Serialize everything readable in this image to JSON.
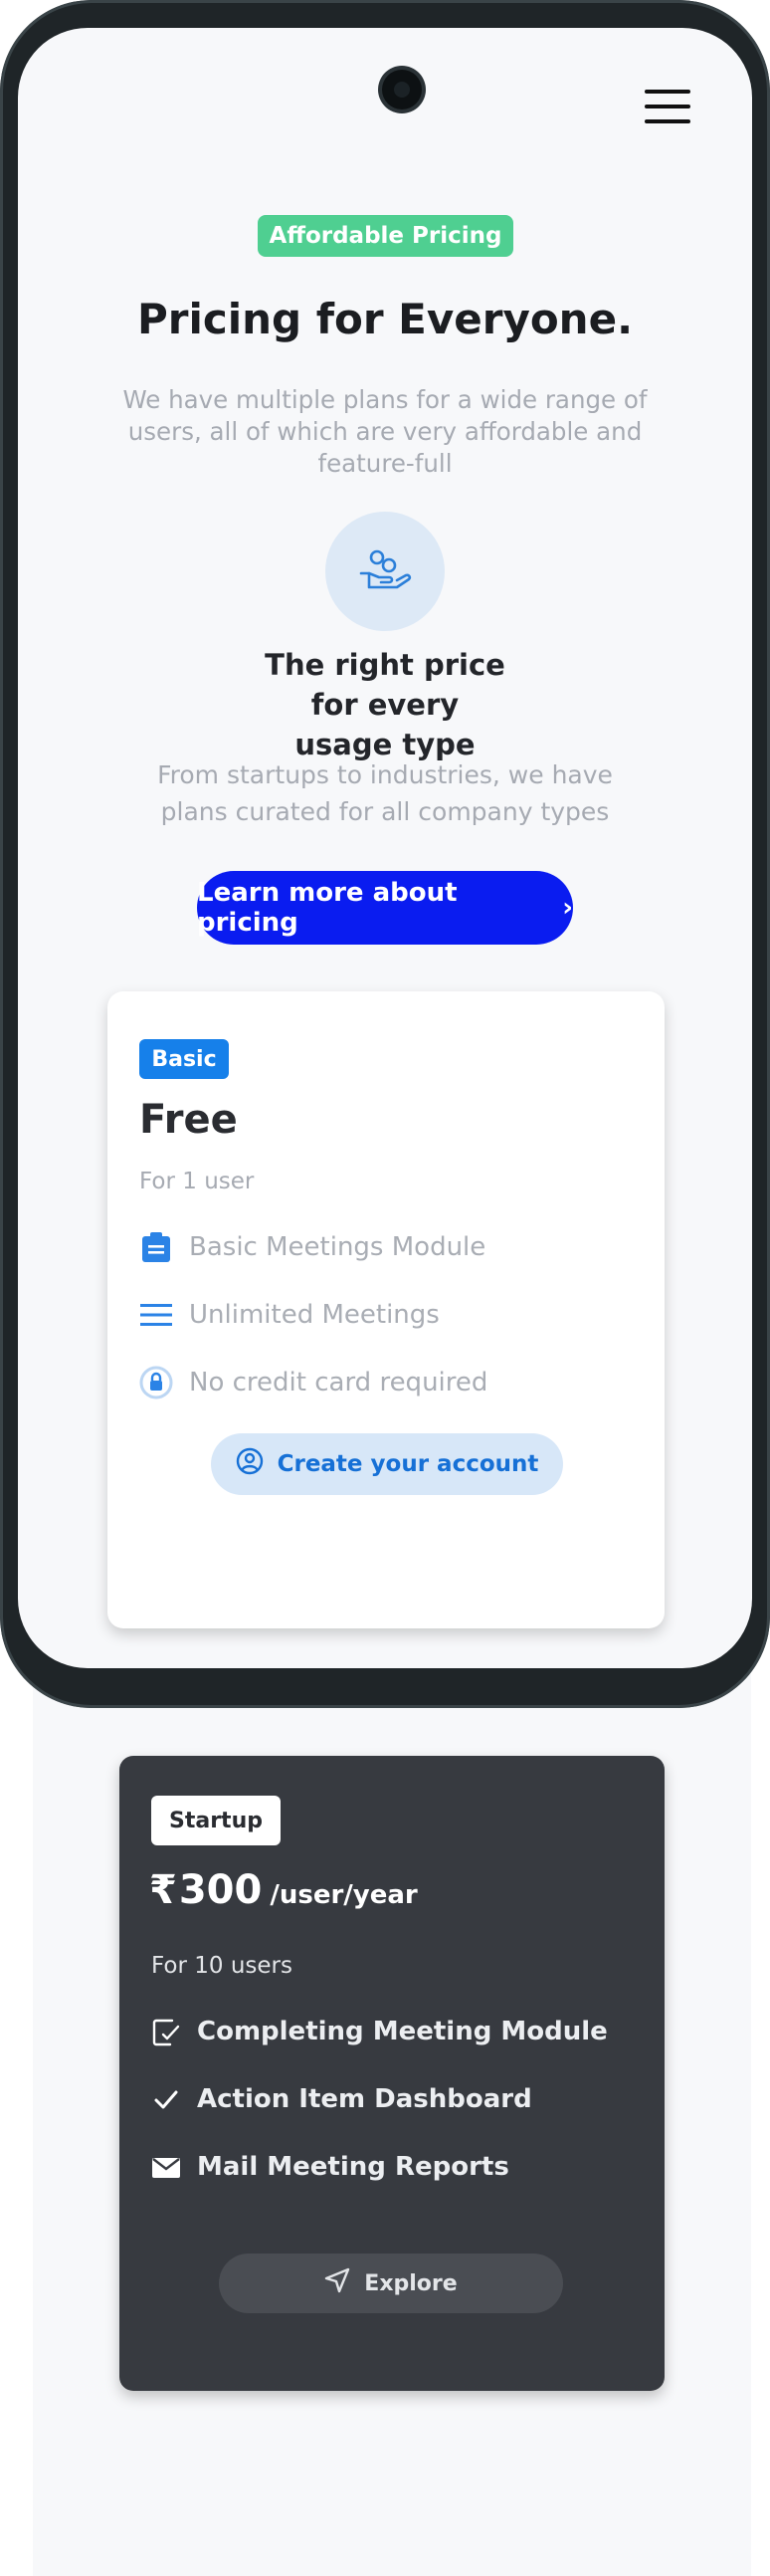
{
  "header": {
    "badge": "Affordable Pricing",
    "title": "Pricing for Everyone.",
    "subtitle": "We have multiple plans for a wide range of users, all of which are very affordable and feature-full"
  },
  "intro": {
    "icon": "hand-coin-icon",
    "heading": "The right price for every usage type",
    "text": "From startups to industries, we have plans curated for all company types",
    "cta_label": "Learn more about pricing",
    "cta_chevron": "›"
  },
  "plans": [
    {
      "tag": "Basic",
      "price": "Free",
      "users": "For 1 user",
      "features": [
        {
          "icon": "briefcase-icon",
          "label": "Basic Meetings Module"
        },
        {
          "icon": "list-lines-icon",
          "label": "Unlimited Meetings"
        },
        {
          "icon": "lock-icon",
          "label": "No credit card required"
        }
      ],
      "button": {
        "icon": "user-circle-icon",
        "label": "Create your account"
      }
    },
    {
      "tag": "Startup",
      "currency": "₹",
      "price": "300",
      "period": "/user/year",
      "users": "For 10 users",
      "features": [
        {
          "icon": "clipboard-check-icon",
          "label": "Completing Meeting Module"
        },
        {
          "icon": "check-icon",
          "label": "Action Item Dashboard"
        },
        {
          "icon": "mail-icon",
          "label": "Mail Meeting Reports"
        }
      ],
      "button": {
        "icon": "send-icon",
        "label": "Explore"
      }
    }
  ],
  "colors": {
    "accent_blue": "#0a1cf0",
    "badge_green": "#4fcf91",
    "basic_tag": "#1680ea",
    "startup_card": "#373a40"
  }
}
